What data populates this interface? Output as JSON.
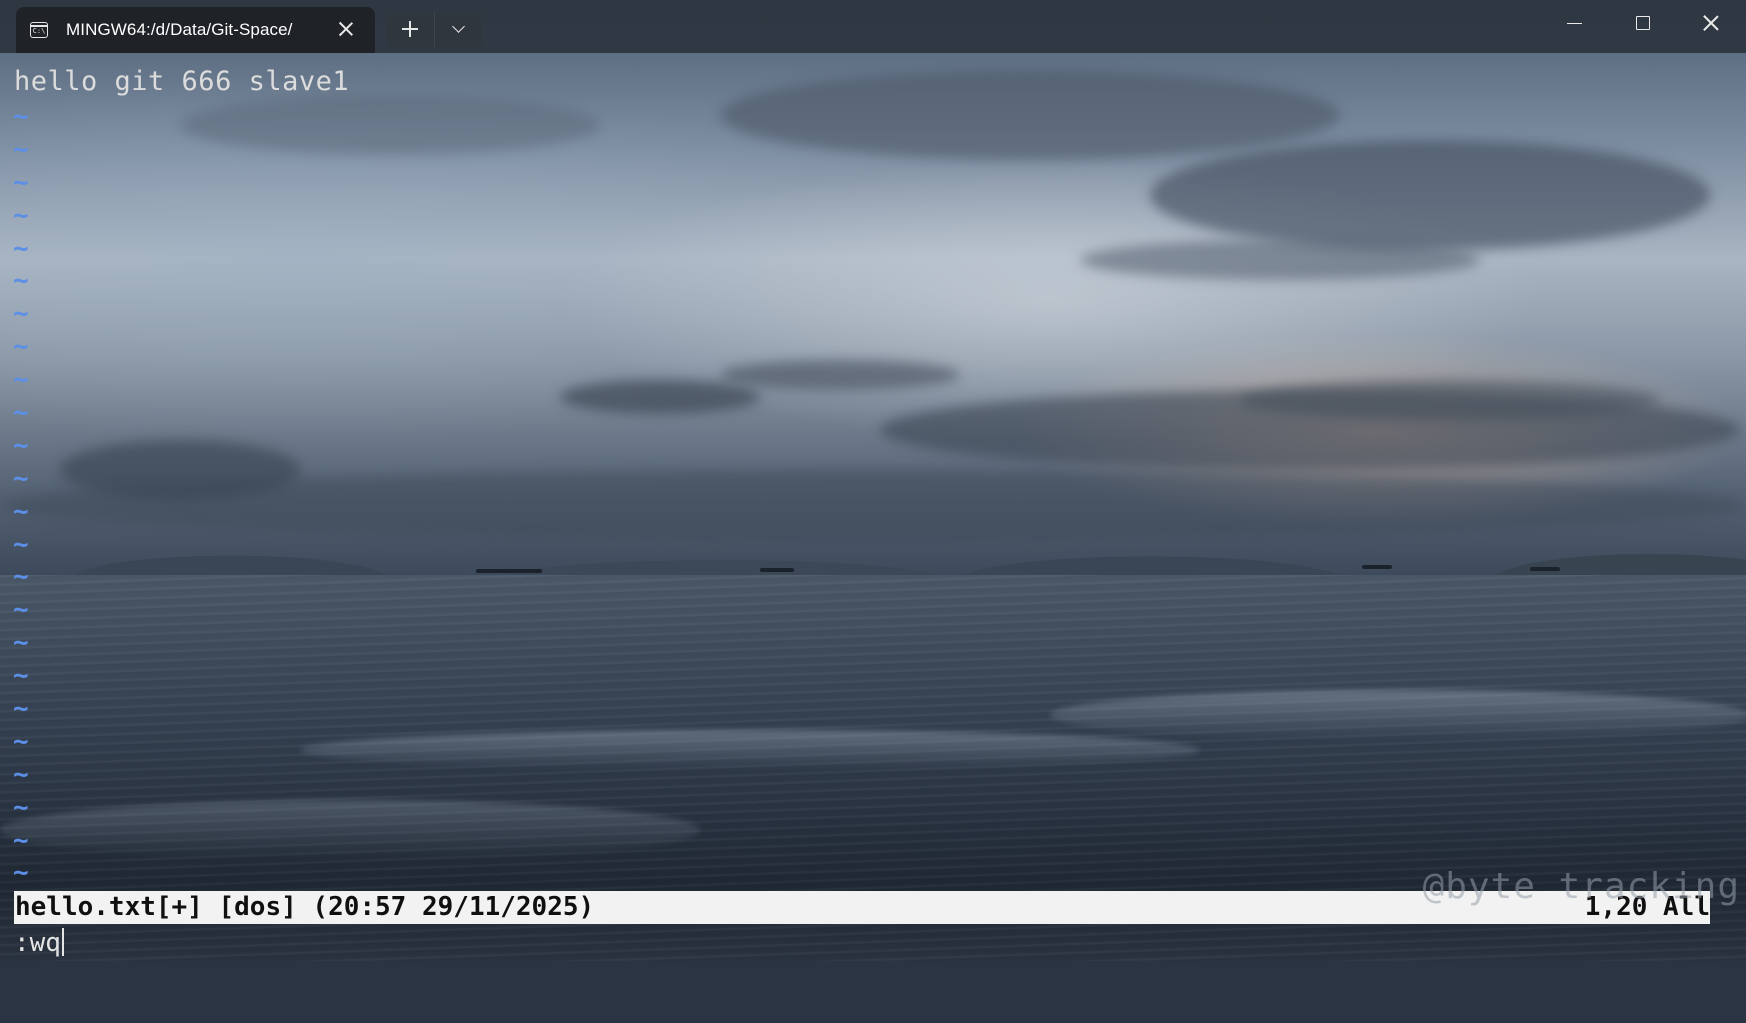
{
  "window": {
    "tab_title": "MINGW64:/d/Data/Git-Space/",
    "tab_icon": "terminal-icon",
    "tab_icon_text": "C:\\",
    "new_tab_icon": "plus-icon",
    "dropdown_icon": "chevron-down-icon",
    "controls": [
      "minimize-icon",
      "maximize-icon",
      "close-icon"
    ]
  },
  "vim": {
    "buffer_lines": [
      "hello git 666 slave1"
    ],
    "empty_line_marker": "~",
    "empty_line_count": 24,
    "status_left": "hello.txt[+] [dos] (20:57 29/11/2025)",
    "status_right": "1,20 All",
    "command_line": ":wq"
  },
  "watermark": "@byte tracking",
  "colors": {
    "tilde": "#5b8fe8",
    "status_bg": "#f2f2f2",
    "text": "#dcdcdc"
  }
}
